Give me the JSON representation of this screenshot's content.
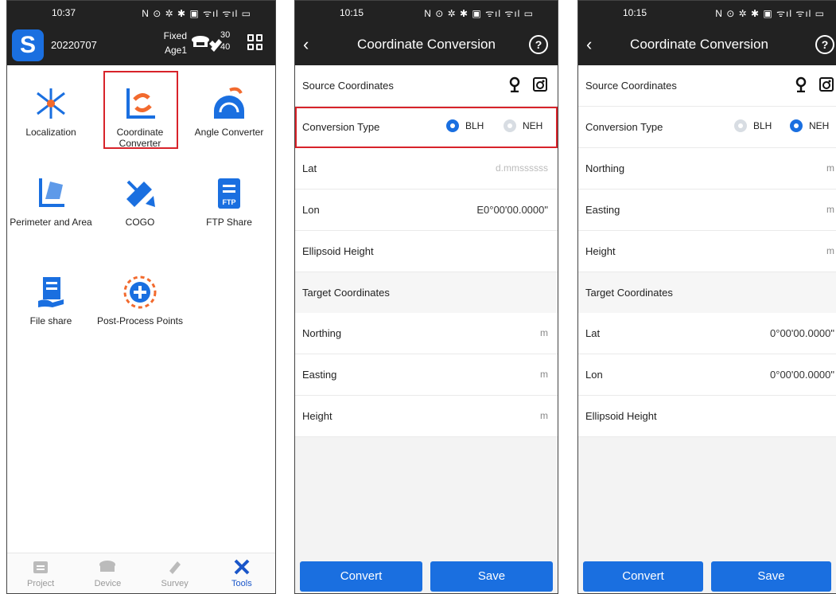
{
  "phone1": {
    "status_time": "10:37",
    "status_icons": "N ⊙ ✲ ✱ ▣ ᯤıl ᯤıl ▭",
    "project_name": "20220707",
    "fix_status": "Fixed",
    "age": "Age1",
    "sat_used": "30",
    "sat_total": "40",
    "tools": [
      {
        "label": "Localization",
        "icon": "localization-icon"
      },
      {
        "label": "Coordinate Converter",
        "icon": "coordinate-converter-icon"
      },
      {
        "label": "Angle Converter",
        "icon": "angle-converter-icon"
      },
      {
        "label": "Perimeter and Area",
        "icon": "perimeter-area-icon"
      },
      {
        "label": "COGO",
        "icon": "cogo-icon"
      },
      {
        "label": "FTP Share",
        "icon": "ftp-share-icon"
      },
      {
        "label": "File share",
        "icon": "file-share-icon"
      },
      {
        "label": "Post-Process Points",
        "icon": "post-process-icon"
      }
    ],
    "ftp_badge": "FTP",
    "nav": [
      {
        "label": "Project",
        "icon": "project-icon"
      },
      {
        "label": "Device",
        "icon": "device-icon"
      },
      {
        "label": "Survey",
        "icon": "survey-icon"
      },
      {
        "label": "Tools",
        "icon": "tools-icon"
      }
    ]
  },
  "phone2": {
    "status_time": "10:15",
    "status_icons": "N ⊙ ✲ ✱ ▣ ᯤıl ᯤıl ▭",
    "title": "Coordinate Conversion",
    "source_label": "Source Coordinates",
    "conversion_type_label": "Conversion Type",
    "opt_blh": "BLH",
    "opt_neh": "NEH",
    "lat_label": "Lat",
    "lat_placeholder": "d.mmssssss",
    "lon_label": "Lon",
    "lon_value": "E0°00'00.0000\"",
    "ellipsoid_label": "Ellipsoid Height",
    "target_label": "Target Coordinates",
    "northing_label": "Northing",
    "easting_label": "Easting",
    "height_label": "Height",
    "unit_m": "m",
    "convert_label": "Convert",
    "save_label": "Save"
  },
  "phone3": {
    "status_time": "10:15",
    "status_icons": "N ⊙ ✲ ✱ ▣ ᯤıl ᯤıl ▭",
    "title": "Coordinate Conversion",
    "source_label": "Source Coordinates",
    "conversion_type_label": "Conversion Type",
    "opt_blh": "BLH",
    "opt_neh": "NEH",
    "northing_label": "Northing",
    "easting_label": "Easting",
    "height_label": "Height",
    "unit_m": "m",
    "target_label": "Target Coordinates",
    "lat_label": "Lat",
    "lat_value": "0°00'00.0000\"",
    "lon_label": "Lon",
    "lon_value": "0°00'00.0000\"",
    "ellipsoid_label": "Ellipsoid Height",
    "convert_label": "Convert",
    "save_label": "Save"
  },
  "colors": {
    "accent": "#1a6fe0",
    "header": "#222222",
    "highlight": "#d8232a",
    "icon_blue": "#1a6fe0",
    "icon_orange": "#f26a2e"
  }
}
